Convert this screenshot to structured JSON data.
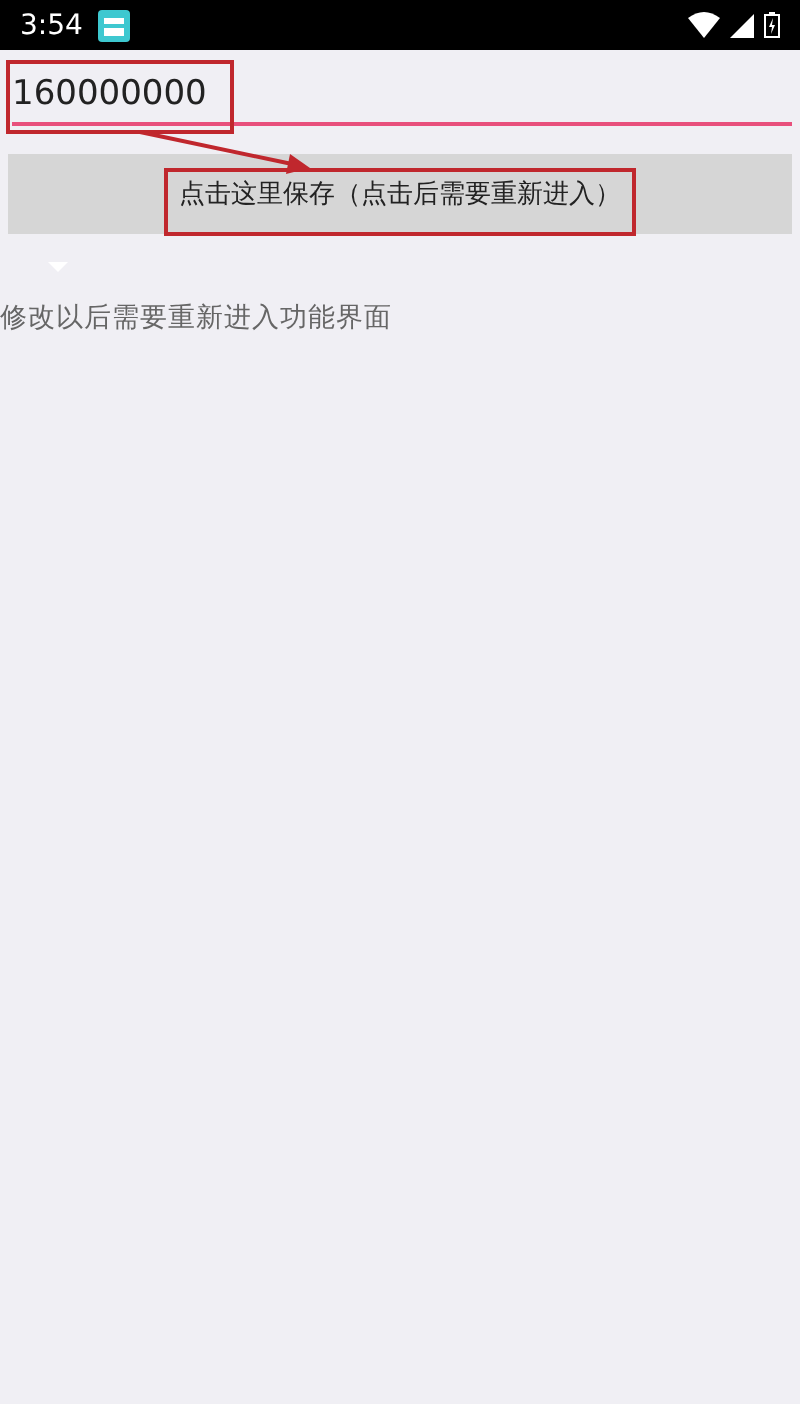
{
  "status_bar": {
    "time": "3:54"
  },
  "field": {
    "value": "160000000"
  },
  "save_button": {
    "label": "点击这里保存（点击后需要重新进入）"
  },
  "note": "修改以后需要重新进入功能界面"
}
